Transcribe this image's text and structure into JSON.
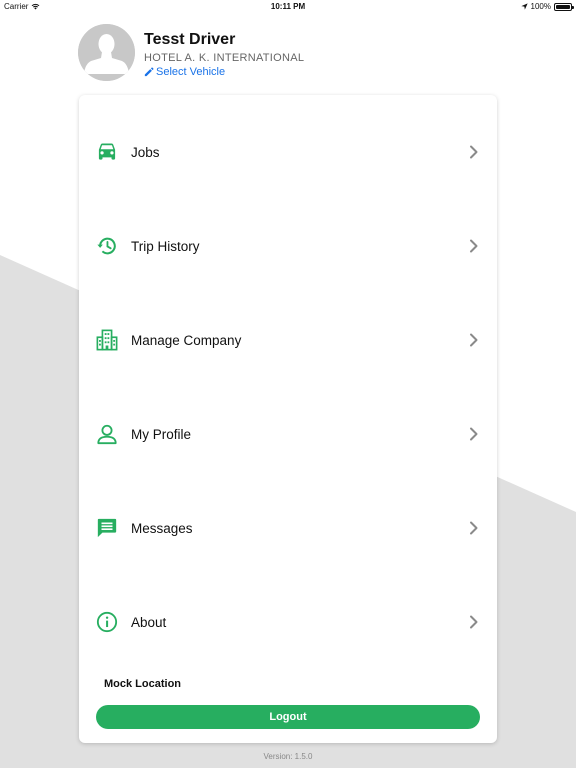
{
  "status_bar": {
    "carrier": "Carrier",
    "time": "10:11 PM",
    "battery": "100%",
    "battery_level": 1.0
  },
  "profile": {
    "name": "Tesst Driver",
    "company": "HOTEL A. K. INTERNATIONAL",
    "select_vehicle_label": "Select Vehicle"
  },
  "menu": {
    "items": [
      {
        "label": "Jobs",
        "icon": "car-icon"
      },
      {
        "label": "Trip History",
        "icon": "history-icon"
      },
      {
        "label": "Manage Company",
        "icon": "building-icon"
      },
      {
        "label": "My Profile",
        "icon": "person-icon"
      },
      {
        "label": "Messages",
        "icon": "message-icon"
      },
      {
        "label": "About",
        "icon": "info-icon"
      }
    ]
  },
  "mock_location_label": "Mock Location",
  "logout_label": "Logout",
  "version_text": "Version: 1.5.0",
  "colors": {
    "accent": "#27ae60",
    "link": "#1a73e8",
    "background_shape": "#e0e0e0"
  }
}
